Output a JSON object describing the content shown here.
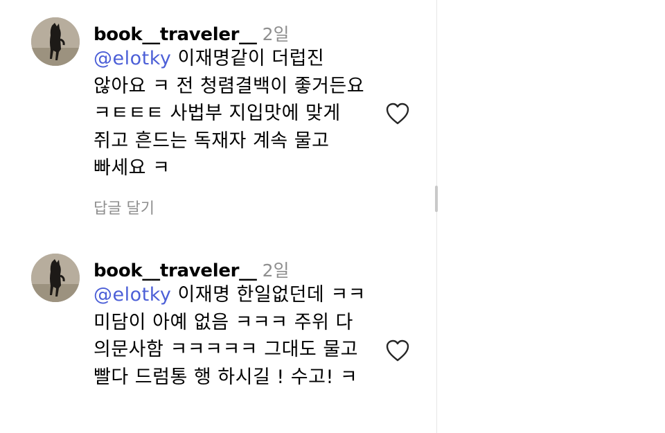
{
  "colors": {
    "mention": "#4c5fd7",
    "secondary_text": "#8e8e8e",
    "text": "#000000"
  },
  "comments": [
    {
      "username": "book__traveler__",
      "time": "2일",
      "mention": "@elotky",
      "text": " 이재명같이 더럽진 않아요 ㅋ 전 청렴결백이 좋거든요 ㅋㅌㅌㅌ 사법부 지입맛에 맞게 쥐고 흔드는 독재자 계속 물고 빠세요 ㅋ",
      "reply_label": "답글 달기",
      "like_icon": "heart-outline-icon"
    },
    {
      "username": "book__traveler__",
      "time": "2일",
      "mention": "@elotky",
      "text": " 이재명 한일없던데 ㅋㅋ 미담이 아예 없음 ㅋㅋㅋ 주위 다 의문사함 ㅋㅋㅋㅋㅋ 그대도 물고 빨다 드럼통 행 하시길 ! 수고! ㅋ",
      "like_icon": "heart-outline-icon"
    }
  ]
}
